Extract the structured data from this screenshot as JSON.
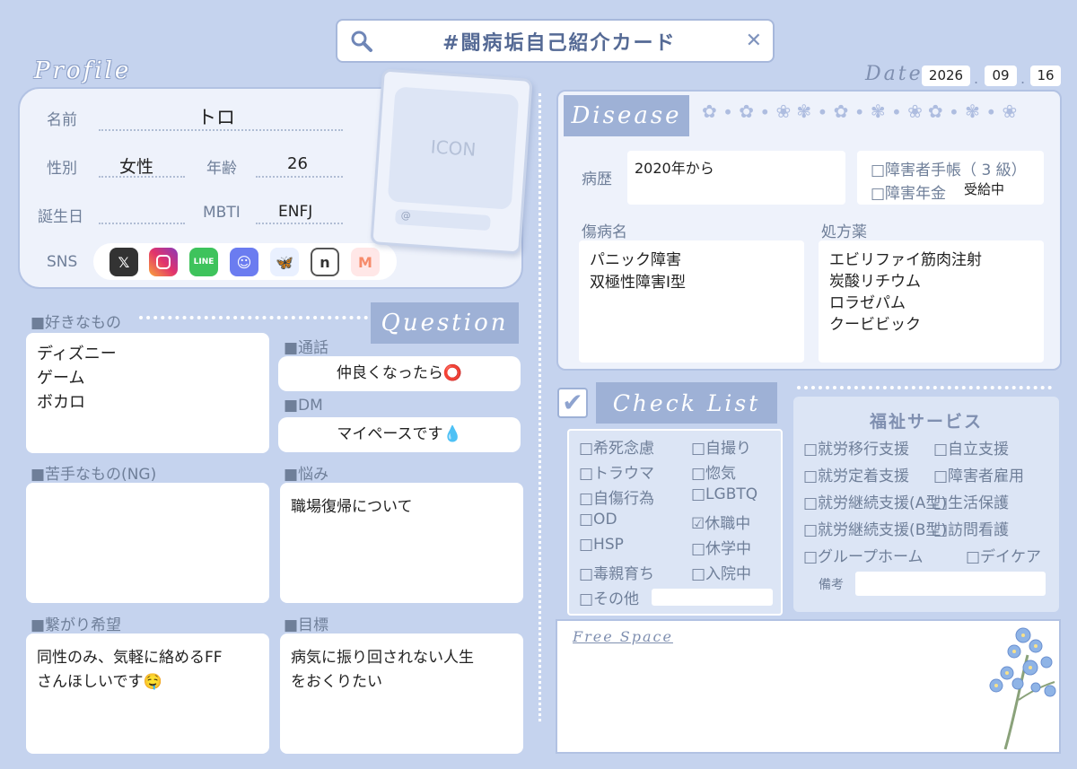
{
  "search": {
    "title": "#闘病垢自己紹介カード"
  },
  "profile": {
    "heading": "Profile",
    "name_label": "名前",
    "name": "トロ",
    "gender_label": "性別",
    "gender": "女性",
    "age_label": "年齢",
    "age": "26",
    "birthday_label": "誕生日",
    "birthday": "",
    "mbti_label": "MBTI",
    "mbti": "ENFJ",
    "sns_label": "SNS",
    "sns_icons": [
      "x-icon",
      "instagram-icon",
      "line-icon",
      "discord-icon",
      "bluesky-icon",
      "note-icon",
      "misskey-icon"
    ]
  },
  "icon_card": {
    "text": "ICON",
    "at": "@"
  },
  "date": {
    "label": "Date",
    "year": "2026",
    "month": "09",
    "day": "16"
  },
  "disease": {
    "heading": "Disease",
    "history_label": "病歴",
    "history": "2020年から",
    "handbook": "□障害者手帳（ 3 級）",
    "pension": "□障害年金",
    "pension_note": "受給中",
    "diagnosis_label": "傷病名",
    "diagnosis": [
      "パニック障害",
      "双極性障害Ⅰ型"
    ],
    "meds_label": "処方薬",
    "meds": [
      "エビリファイ筋肉注射",
      "炭酸リチウム",
      "ロラゼパム",
      "クービビック"
    ]
  },
  "likes": {
    "title": "■好きなもの",
    "items": [
      "ディズニー",
      "ゲーム",
      "ボカロ"
    ]
  },
  "question": {
    "heading": "Question",
    "call_title": "■通話",
    "call": "仲良くなったら⭕",
    "dm_title": "■DM",
    "dm": "マイペースです💧",
    "worry_title": "■悩み",
    "worry": "職場復帰について",
    "goal_title": "■目標",
    "goal": [
      "病気に振り回されない人生",
      "をおくりたい"
    ]
  },
  "dislikes": {
    "title": "■苦手なもの(NG)",
    "items": []
  },
  "connect": {
    "title": "■繋がり希望",
    "items": [
      "同性のみ、気軽に絡めるFF",
      "さんほしいです🤤"
    ]
  },
  "checklist": {
    "heading": "Check List",
    "left": [
      "□希死念慮",
      "□トラウマ",
      "□自傷行為",
      "□OD",
      "□HSP",
      "□毒親育ち",
      "□その他"
    ],
    "right": [
      "□自撮り",
      "□惚気",
      "□LGBTQ",
      "☑休職中",
      "□休学中",
      "□入院中"
    ]
  },
  "welfare": {
    "title": "福祉サービス",
    "left": [
      "□就労移行支援",
      "□就労定着支援",
      "□就労継続支援(A型)",
      "□就労継続支援(B型)",
      "□グループホーム"
    ],
    "right": [
      "□自立支援",
      "□障害者雇用",
      "□生活保護",
      "□訪問看護",
      "□デイケア"
    ],
    "note_label": "備考"
  },
  "free_space": {
    "title": "Free Space"
  },
  "colors": {
    "background": "#c5d3ee",
    "accent": "#9eb1d6",
    "panel": "#eef2fb"
  }
}
